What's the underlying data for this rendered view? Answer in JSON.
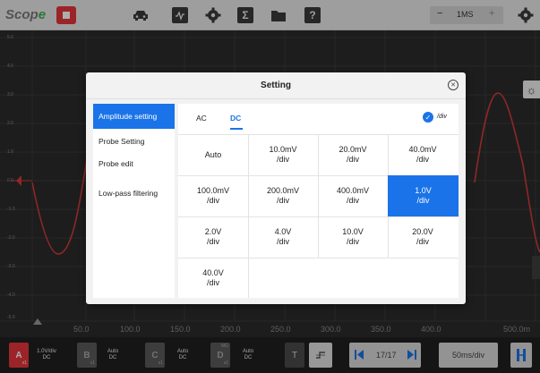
{
  "topbar": {
    "logo_main": "Scop",
    "logo_accent": "e",
    "timebase": "1MS",
    "minus": "−",
    "plus": "+"
  },
  "scope": {
    "y_labels": [
      "5.0",
      "4.0",
      "3.0",
      "2.0",
      "1.0",
      "0.0",
      "-1.0",
      "-2.0",
      "-3.0",
      "-4.0",
      "-5.0"
    ],
    "x_labels": [
      "50.0",
      "100.0",
      "150.0",
      "200.0",
      "250.0",
      "300.0",
      "350.0",
      "400.0",
      "500.0m"
    ]
  },
  "dialog": {
    "title": "Setting",
    "menu": [
      {
        "label": "Amplitude setting",
        "active": true
      },
      {
        "label": "Probe Setting",
        "active": false
      },
      {
        "label": "Probe edit",
        "active": false
      },
      {
        "label": "Low-pass filtering",
        "active": false
      }
    ],
    "tabs": [
      {
        "label": "AC",
        "active": false
      },
      {
        "label": "DC",
        "active": true
      }
    ],
    "per_div_label": "/div",
    "options": [
      [
        "Auto",
        "10.0mV\n/div",
        "20.0mV\n/div",
        "40.0mV\n/div"
      ],
      [
        "100.0mV\n/div",
        "200.0mV\n/div",
        "400.0mV\n/div",
        "1.0V\n/div"
      ],
      [
        "2.0V\n/div",
        "4.0V\n/div",
        "10.0V\n/div",
        "20.0V\n/div"
      ],
      [
        "40.0V\n/div"
      ]
    ],
    "selected_option": "1.0V\n/div"
  },
  "bottombar": {
    "ch_a": {
      "label": "A",
      "sub": "x1",
      "info1": "1.0V/div",
      "info2": "DC"
    },
    "ch_b": {
      "label": "B",
      "sub": "x1",
      "info1": "Auto",
      "info2": "DC"
    },
    "ch_c": {
      "label": "C",
      "sub": "x1",
      "info1": "Auto",
      "info2": "DC"
    },
    "ch_d": {
      "label": "D",
      "sub": "x1",
      "info1": "Auto",
      "info2": "DC"
    },
    "ch_d_badge": "MG",
    "trigger_label": "T",
    "page": "17/17",
    "timebase": "50ms/div"
  },
  "colors": {
    "accent": "#1a73e8",
    "channel_a": "#e5353b",
    "waveform": "#d23a3a",
    "stop": "#e5353b"
  }
}
